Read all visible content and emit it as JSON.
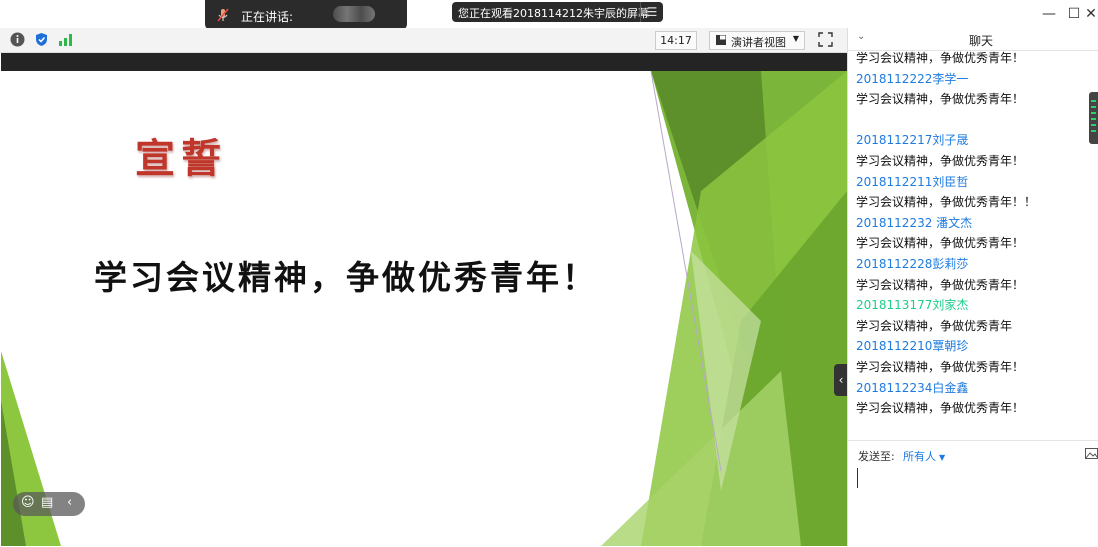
{
  "top": {
    "speaking_label": "正在讲话:",
    "viewing_label": "您正在观看2018114212朱宇辰的屏幕",
    "viewing_menu_icon": "menu-icon"
  },
  "toolbar": {
    "time": "14:17",
    "view_mode": "演讲者视图"
  },
  "slide": {
    "oath_title": "宣誓",
    "headline": "学习会议精神，争做优秀青年！",
    "colors": {
      "green_dark": "#6aa52e",
      "green_mid": "#8dc63f",
      "green_light": "#c9e3a5"
    }
  },
  "chat": {
    "title": "聊天",
    "messages": [
      {
        "text": "学习会议精神，争做优秀青年！"
      },
      {
        "sender": "2018112222李学一",
        "text": "学习会议精神，争做优秀青年！"
      },
      {
        "blank": true
      },
      {
        "sender": "2018112217刘子晟",
        "text": "学习会议精神，争做优秀青年！"
      },
      {
        "sender": "2018112211刘臣哲",
        "text": "学习会议精神，争做优秀青年！！"
      },
      {
        "sender": "2018112232 潘文杰",
        "text": "学习会议精神，争做优秀青年！"
      },
      {
        "sender": "2018112228彭莉莎",
        "text": "学习会议精神，争做优秀青年！"
      },
      {
        "sender": "2018113177刘家杰",
        "sender_color": "green",
        "text": "学习会议精神，争做优秀青年"
      },
      {
        "sender": "2018112210覃朝珍",
        "text": "学习会议精神，争做优秀青年！"
      },
      {
        "sender": "2018112234白金鑫",
        "text": "学习会议精神，争做优秀青年！"
      }
    ],
    "send_to_label": "发送至:",
    "recipient": "所有人"
  }
}
